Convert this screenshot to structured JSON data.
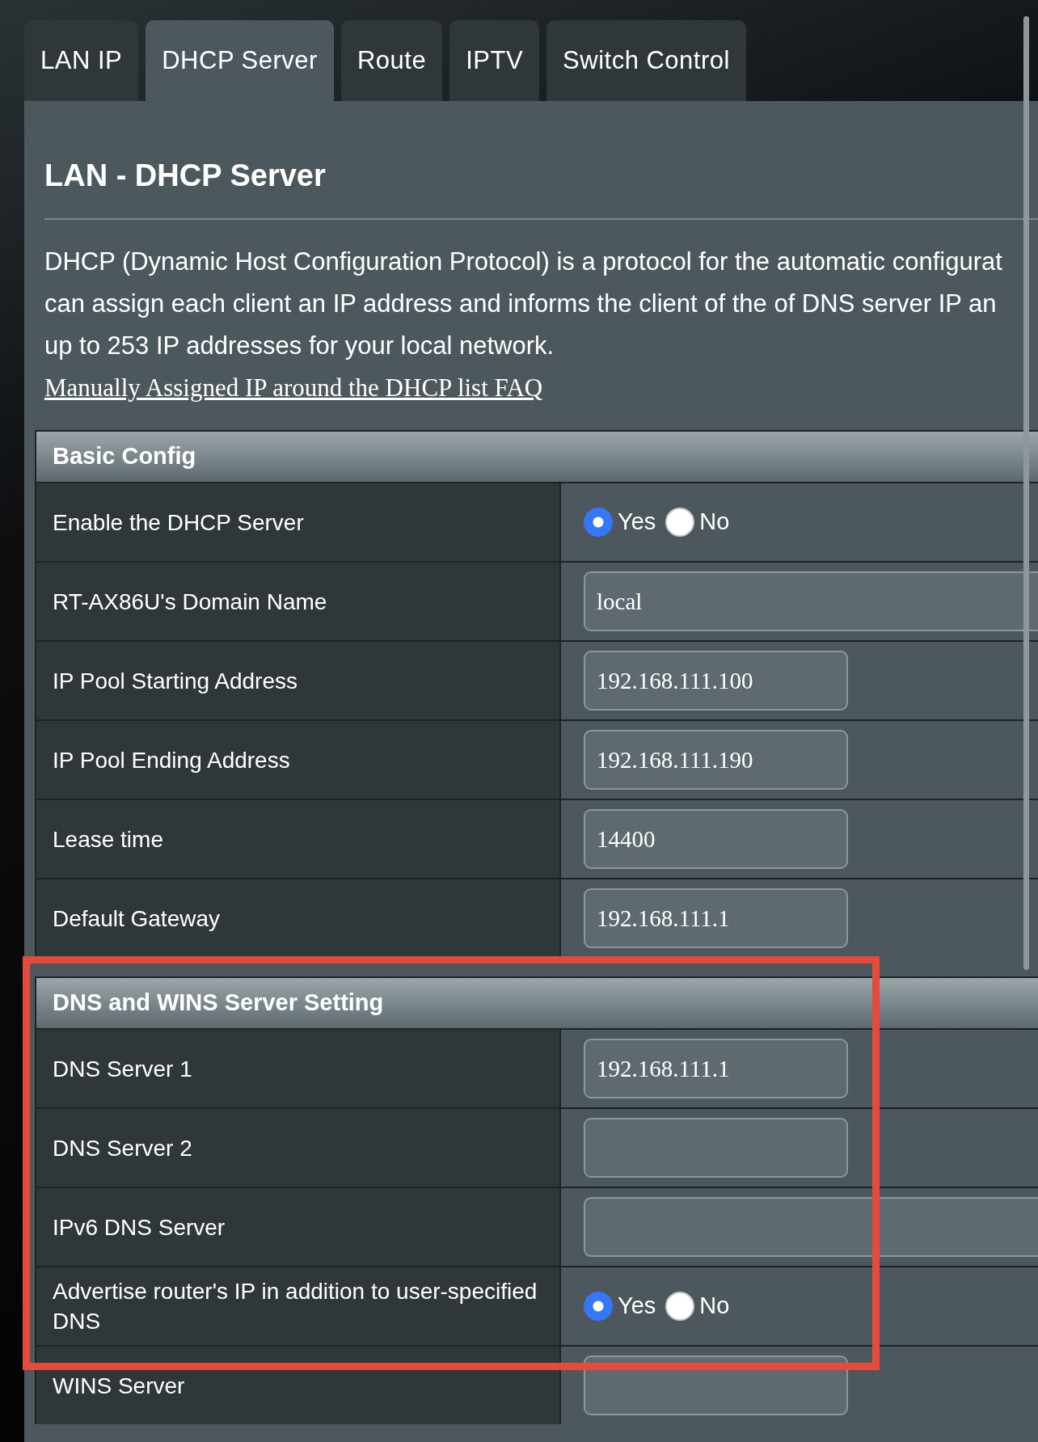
{
  "tabs": [
    {
      "label": "LAN IP",
      "selected": false
    },
    {
      "label": "DHCP Server",
      "selected": true
    },
    {
      "label": "Route",
      "selected": false
    },
    {
      "label": "IPTV",
      "selected": false
    },
    {
      "label": "Switch Control",
      "selected": false
    }
  ],
  "title": "LAN - DHCP Server",
  "description_lines": [
    "DHCP (Dynamic Host Configuration Protocol) is a protocol for the automatic configurat",
    "can assign each client an IP address and informs the client of the of DNS server IP an",
    "up to 253 IP addresses for your local network."
  ],
  "faq_link": "Manually Assigned IP around the DHCP list FAQ",
  "sections": [
    {
      "title": "Basic Config",
      "rows": [
        {
          "label": "Enable the DHCP Server",
          "kind": "radio",
          "options": [
            {
              "label": "Yes",
              "selected": true
            },
            {
              "label": "No",
              "selected": false
            }
          ]
        },
        {
          "label": "RT-AX86U's Domain Name",
          "kind": "wide-field",
          "value": "local"
        },
        {
          "label": "IP Pool Starting Address",
          "kind": "field",
          "value": "192.168.111.100"
        },
        {
          "label": "IP Pool Ending Address",
          "kind": "field",
          "value": "192.168.111.190"
        },
        {
          "label": "Lease time",
          "kind": "field",
          "value": "14400"
        },
        {
          "label": "Default Gateway",
          "kind": "field",
          "value": "192.168.111.1"
        }
      ]
    },
    {
      "title": "DNS and WINS Server Setting",
      "rows": [
        {
          "label": "DNS Server 1",
          "kind": "field",
          "value": "192.168.111.1"
        },
        {
          "label": "DNS Server 2",
          "kind": "field"
        },
        {
          "label": "IPv6 DNS Server",
          "kind": "wide-field"
        },
        {
          "label": "Advertise router's IP in addition to user-specified DNS",
          "kind": "radio",
          "options": [
            {
              "label": "Yes",
              "selected": true
            },
            {
              "label": "No",
              "selected": false
            }
          ]
        },
        {
          "label": "WINS Server",
          "kind": "field"
        }
      ]
    }
  ]
}
